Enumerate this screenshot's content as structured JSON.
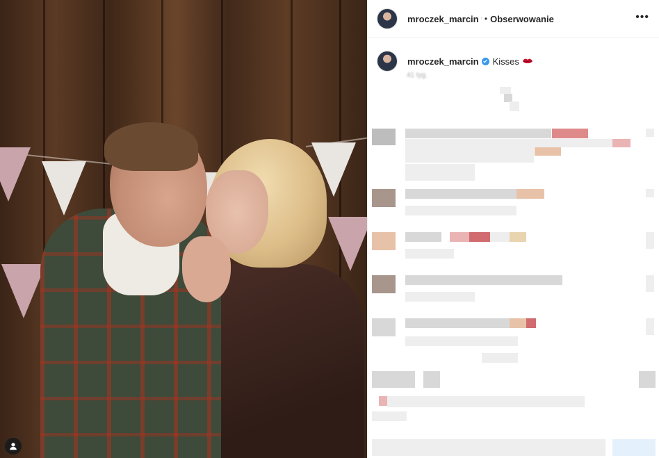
{
  "header": {
    "username": "mroczek_marcin",
    "verified_mark": "ˡ",
    "separator": "•",
    "follow_label": "Obserwowanie",
    "more_label": "•••"
  },
  "caption": {
    "username": "mroczek_marcin",
    "text": "Kisses",
    "time": "41 tyg."
  },
  "icons": {
    "avatar": "avatar-image",
    "verified": "verified-badge-icon",
    "emoji": "kiss-lips-icon",
    "more": "more-options-icon",
    "tagged": "person-tag-icon"
  },
  "colors": {
    "text": "#262626",
    "muted": "#a8a8a8",
    "verified": "#3897f0",
    "border": "#efefef"
  }
}
